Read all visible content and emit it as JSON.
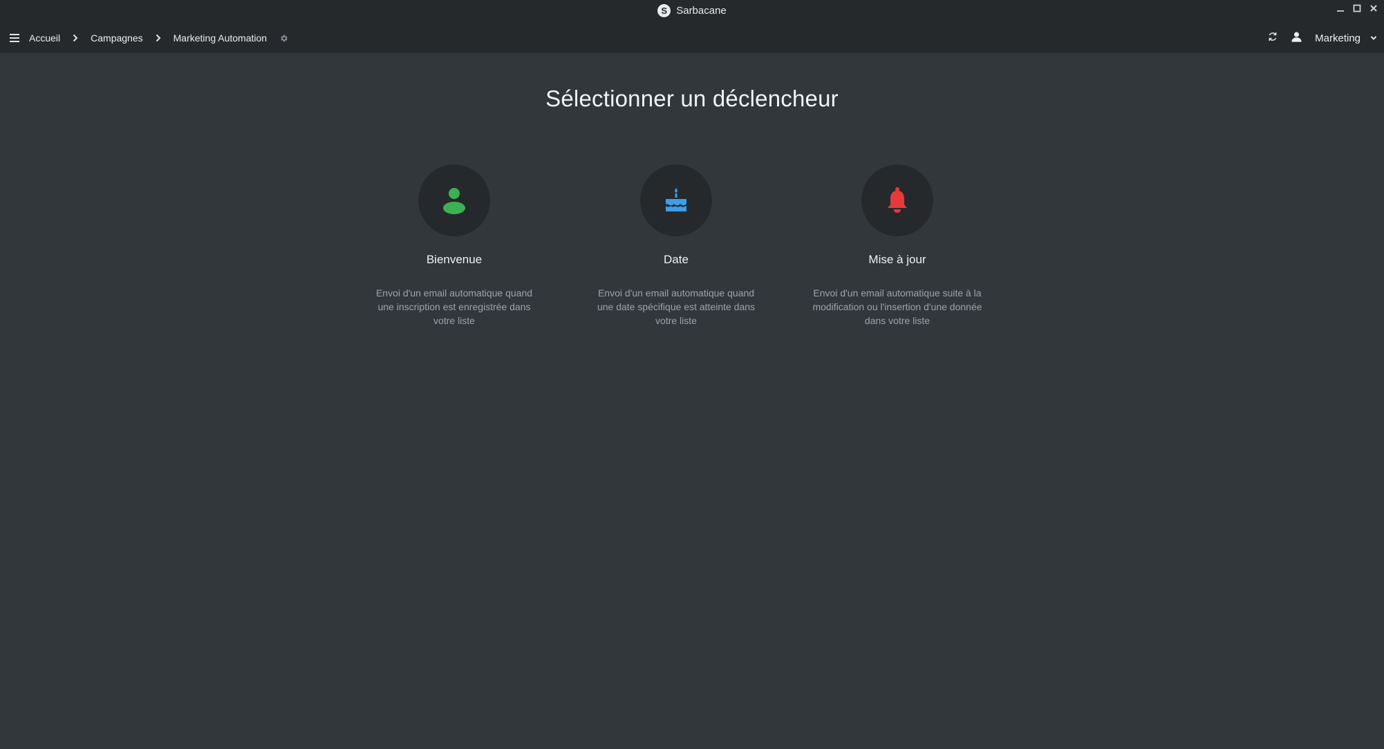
{
  "window": {
    "app_title": "Sarbacane",
    "logo_letter": "S",
    "controls": [
      "minimize",
      "maximize",
      "close"
    ]
  },
  "nav": {
    "breadcrumb": [
      {
        "label": "Accueil"
      },
      {
        "label": "Campagnes"
      },
      {
        "label": "Marketing Automation"
      }
    ],
    "account_label": "Marketing"
  },
  "main": {
    "title": "Sélectionner un déclencheur",
    "triggers": [
      {
        "name": "Bienvenue",
        "icon": "user-icon",
        "color": "#3cb153",
        "description": "Envoi d'un email automatique quand une inscription est enregistrée dans votre liste"
      },
      {
        "name": "Date",
        "icon": "birthday-cake-icon",
        "color": "#3f9ee8",
        "description": "Envoi d'un email automatique quand une date spécifique est atteinte dans votre liste"
      },
      {
        "name": "Mise à jour",
        "icon": "bell-icon",
        "color": "#e8393a",
        "description": "Envoi d'un email automatique suite à la modification ou l'insertion d'une donnée dans votre liste"
      }
    ]
  }
}
